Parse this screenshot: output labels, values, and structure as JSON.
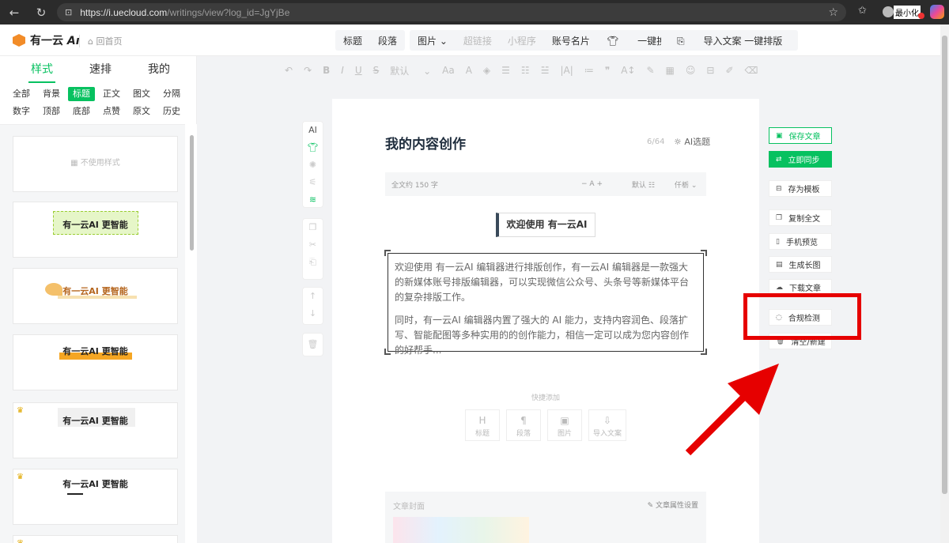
{
  "browser": {
    "url_host": "https://i.uecloud.com",
    "url_path": "/writings/view?log_id=JgYjBe",
    "minimize_tooltip": "最小化"
  },
  "app": {
    "brand": "有一云",
    "brand_suffix": "Aı",
    "home_link": "回首页"
  },
  "top_toolbar": {
    "group1": [
      "标题",
      "段落"
    ],
    "group2": [
      {
        "label": "图片 ⌄",
        "disabled": false
      },
      {
        "label": "超链接",
        "disabled": true
      },
      {
        "label": "小程序",
        "disabled": true
      },
      {
        "label": "账号名片",
        "disabled": false
      }
    ],
    "one_click_skin": "一键换肤",
    "import_layout": "导入文案 一键排版"
  },
  "left_panel": {
    "tabs": [
      "样式",
      "速排",
      "我的"
    ],
    "active_tab": 0,
    "categories": [
      "全部",
      "背景",
      "标题",
      "正文",
      "图文",
      "分隔",
      "数字",
      "顶部",
      "底部",
      "点赞",
      "原文",
      "历史"
    ],
    "active_category": 2,
    "no_style_label": "不使用样式",
    "style_sample_text": "有一云AI 更智能"
  },
  "format_toolbar": {
    "font_default": "默认"
  },
  "editor": {
    "title": "我的内容创作",
    "title_count": "6/64",
    "ai_topic": "AI选题",
    "word_count": "全文约 150 字",
    "font_size_label": "A",
    "line_spacing_default": "默认",
    "indent_label": "仟栃",
    "heading_text": "欢迎使用 有一云AI",
    "paragraph1": "欢迎使用 有一云AI 编辑器进行排版创作，有一云AI 编辑器是一款强大的新媒体账号排版编辑器，可以实现微信公众号、头条号等新媒体平台的复杂排版工作。",
    "paragraph2": "同时，有一云AI 编辑器内置了强大的 AI 能力，支持内容润色、段落扩写、智能配图等多种实用的的创作能力，相信一定可以成为您内容创作的好帮手...",
    "quick_add_title": "快捷添加",
    "quick_add_items": [
      {
        "icon": "H",
        "label": "标题"
      },
      {
        "icon": "¶",
        "label": "段落"
      },
      {
        "icon": "▣",
        "label": "图片"
      },
      {
        "icon": "⇩",
        "label": "导入文案"
      }
    ],
    "cover_label": "文章封面",
    "cover_settings": "文章属性设置"
  },
  "right_actions": {
    "save": "保存文章",
    "sync": "立即同步",
    "save_template": "存为模板",
    "copy_all": "复制全文",
    "mobile_preview": "手机预览",
    "long_image": "生成长图",
    "download": "下载文章",
    "compliance_check": "合规检测",
    "clear_new": "清空/新建"
  },
  "colors": {
    "accent": "#07c160",
    "annotation": "#e60000"
  }
}
